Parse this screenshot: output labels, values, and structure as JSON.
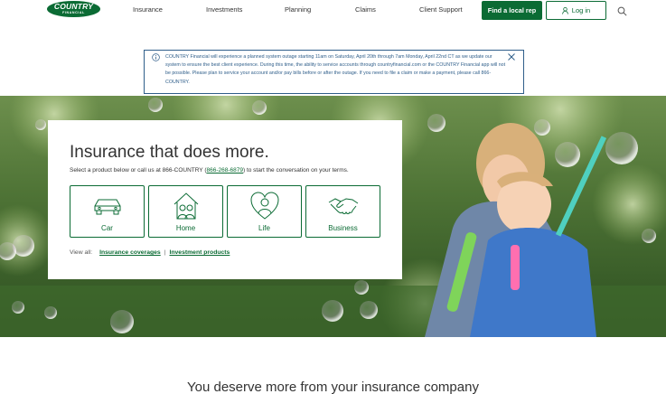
{
  "header": {
    "logo_line1": "COUNTRY",
    "logo_line2": "FINANCIAL",
    "nav": [
      "Insurance",
      "Investments",
      "Planning",
      "Claims",
      "Client Support"
    ],
    "find_rep_label": "Find a local rep",
    "login_label": "Log in",
    "search_icon": "search-icon"
  },
  "alert": {
    "text": "COUNTRY Financial will experience a planned system outage starting 11am on Saturday, April 20th through 7am Monday, April 22nd CT as we update our system to ensure the best client experience. During this time, the ability to service accounts through countryfinancial.com or the COUNTRY Financial app will not be possible. Please plan to service your account and/or pay bills before or after the outage. If you need to file a claim or make a payment, please call 866-COUNTRY."
  },
  "hero_card": {
    "title": "Insurance that does more.",
    "subtitle_before": "Select a product below or call us at 866-COUNTRY (",
    "phone": "866-268-6879",
    "subtitle_after": ") to start the conversation on your terms.",
    "tiles": [
      {
        "label": "Car",
        "icon": "car-icon"
      },
      {
        "label": "Home",
        "icon": "home-icon"
      },
      {
        "label": "Life",
        "icon": "heart-person-icon"
      },
      {
        "label": "Business",
        "icon": "handshake-icon"
      }
    ],
    "view_all_label": "View all:",
    "link_coverages": "Insurance coverages",
    "link_separator": "|",
    "link_investments": "Investment products"
  },
  "bottom": {
    "heading": "You deserve more from your insurance company"
  },
  "colors": {
    "brand_green": "#0b6b34",
    "alert_blue": "#2f5e8a"
  }
}
